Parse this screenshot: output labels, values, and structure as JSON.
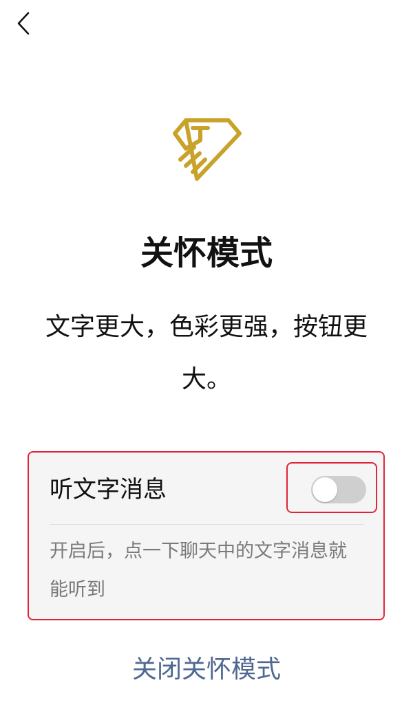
{
  "nav": {
    "back_icon": "chevron-left-icon"
  },
  "logo": {
    "icon": "care-hand-heart-icon",
    "color": "#c9a22a"
  },
  "title": "关怀模式",
  "description": "文字更大，色彩更强，按钮更大。",
  "setting": {
    "label": "听文字消息",
    "enabled": false,
    "description": "开启后，点一下聊天中的文字消息就能听到"
  },
  "close_link": "关闭关怀模式",
  "colors": {
    "highlight": "#e2233a",
    "link": "#4f6891",
    "toggle_off": "#cfcfcf"
  }
}
